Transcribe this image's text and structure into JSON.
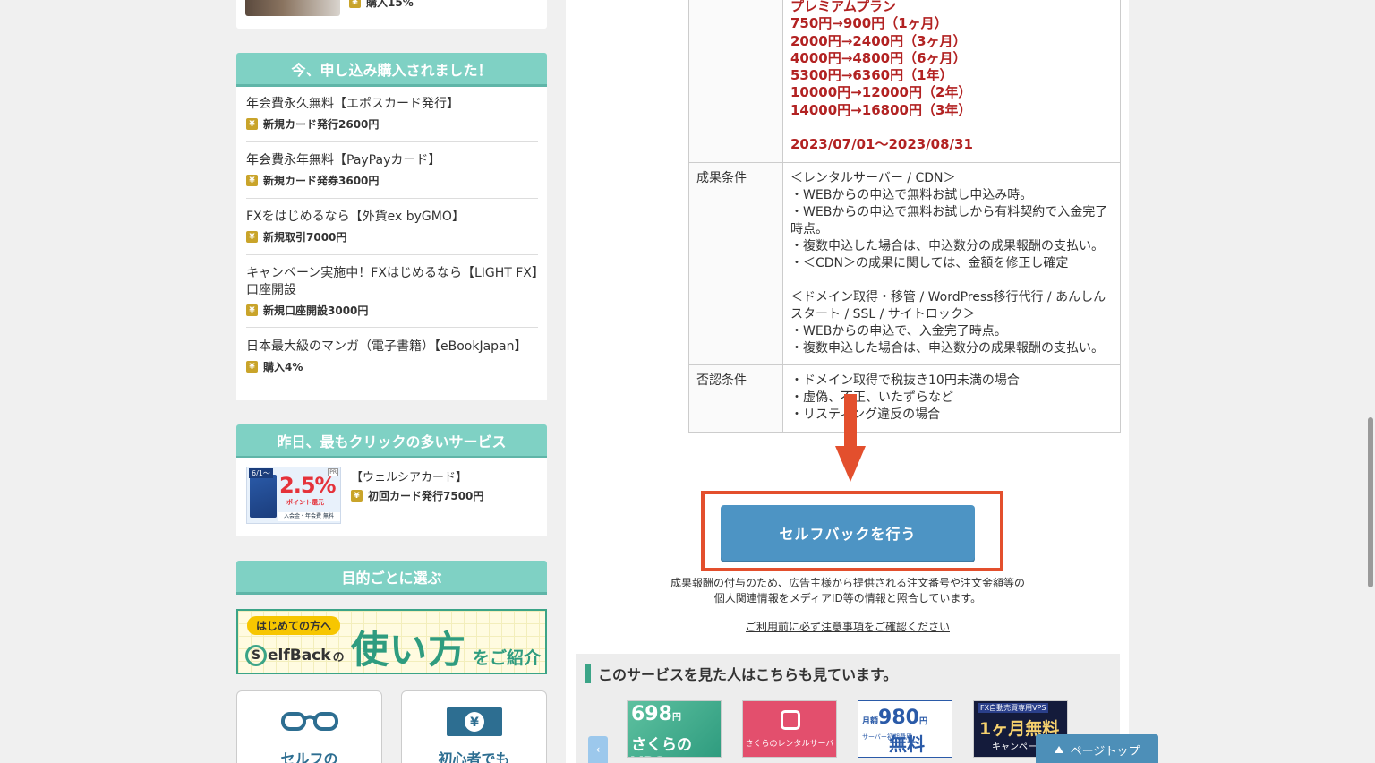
{
  "sidebar": {
    "top_item": {
      "reward": "購入15%"
    },
    "recent": {
      "heading": "今、申し込み購入されました！",
      "items": [
        {
          "title": "年会費永久無料【エポスカード発行】",
          "reward": "新規カード発行2600円"
        },
        {
          "title": "年会費永年無料【PayPayカード】",
          "reward": "新規カード発券3600円"
        },
        {
          "title": "FXをはじめるなら【外貨ex byGMO】",
          "reward": "新規取引7000円"
        },
        {
          "title": "キャンペーン実施中！FXはじめるなら【LIGHT FX】口座開設",
          "reward": "新規口座開設3000円"
        },
        {
          "title": "日本最大級のマンガ（電子書籍）【eBookJapan】",
          "reward": "購入4%"
        }
      ]
    },
    "clicks": {
      "heading": "昨日、最もクリックの多いサービス",
      "item": {
        "name": "【ウェルシアカード】",
        "reward": "初回カード発行7500円"
      },
      "image": {
        "tag": "6/1〜",
        "pct": "2.5%",
        "point": "ポイント還元",
        "bar": "入会金・年会費 無料",
        "pr": "PR"
      }
    },
    "purpose": {
      "heading": "目的ごとに選ぶ"
    },
    "howto": {
      "pill": "はじめての方へ",
      "logo_s": "S",
      "logo_rest": "elfBack",
      "logo_no": "の",
      "big": "使い方",
      "small": "をご紹介"
    },
    "cards": [
      {
        "label": "セルフの",
        "icon": "glasses-icon"
      },
      {
        "label": "初心者でも",
        "icon": "yen-bill-icon"
      }
    ]
  },
  "terms": {
    "plan_lines": [
      "プレミアムプラン",
      "750円→900円（1ヶ月）",
      "2000円→2400円（3ヶ月）",
      "4000円→4800円（6ヶ月）",
      "5300円→6360円（1年）",
      "10000円→12000円（2年）",
      "14000円→16800円（3年）",
      "",
      "2023/07/01〜2023/08/31"
    ],
    "conditions": {
      "label": "成果条件",
      "lines": [
        "＜レンタルサーバー / CDN＞",
        "・WEBからの申込で無料お試し申込み時。",
        "・WEBからの申込で無料お試しから有料契約で入金完了時点。",
        "・複数申込した場合は、申込数分の成果報酬の支払い。",
        "・＜CDN＞の成果に関しては、金額を修正し確定",
        "",
        "＜ドメイン取得・移管 / WordPress移行代行 / あんしんスタート / SSL / サイトロック＞",
        "・WEBからの申込で、入金完了時点。",
        "・複数申込した場合は、申込数分の成果報酬の支払い。"
      ]
    },
    "rejection": {
      "label": "否認条件",
      "lines": [
        "・ドメイン取得で税抜き10円未満の場合",
        "・虚偽、不正、いたずらなど",
        "・リスティング違反の場合"
      ]
    }
  },
  "selfback": {
    "button": "セルフバックを行う",
    "note_line1": "成果報酬の付与のため、広告主様から提供される注文番号や注文金額等の",
    "note_line2": "個人関連情報をメディアID等の情報と照合しています。",
    "link": "ご利用前に必ず注意事項をご確認ください"
  },
  "related": {
    "title": "このサービスを見た人はこちらも見ています。",
    "ads": [
      {
        "price": "698",
        "unit": "円",
        "name": "さくらのVPS"
      },
      {
        "name": "さくらのレンタルサーバ"
      },
      {
        "price": "980",
        "unit": "円",
        "tag": "月額",
        "sub": "サーバー初期費用",
        "free": "無料"
      },
      {
        "tag": "FX自動売買専用VPS",
        "main": "1ヶ月無料",
        "sub": "キャンペーン"
      }
    ]
  },
  "ui": {
    "page_top": "ページトップ",
    "prev": "‹",
    "yen_glyph": "¥"
  },
  "colors": {
    "accent_teal": "#7fd1c4",
    "button_blue": "#4d94c4",
    "highlight_red": "#e34f2d",
    "plan_red": "#b22222"
  }
}
